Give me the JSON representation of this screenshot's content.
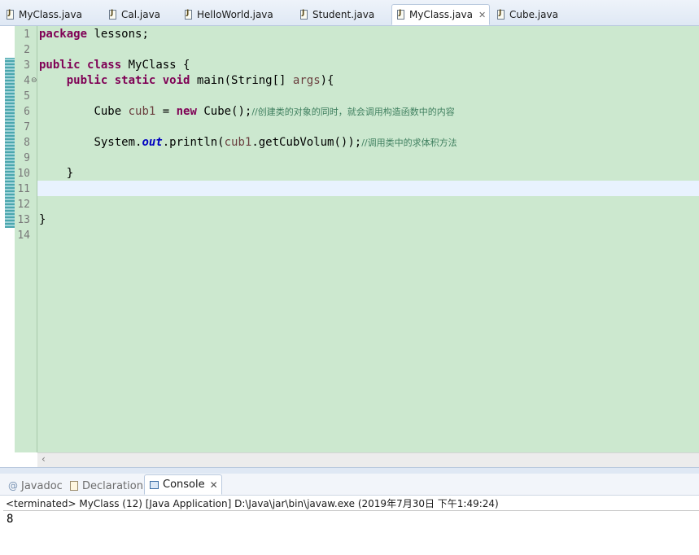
{
  "editor_tabs": [
    {
      "label": "MyClass.java",
      "active": false
    },
    {
      "label": "Cal.java",
      "active": false
    },
    {
      "label": "HelloWorld.java",
      "active": false
    },
    {
      "label": "Student.java",
      "active": false
    },
    {
      "label": "MyClass.java",
      "active": true,
      "close": "✕"
    },
    {
      "label": "Cube.java",
      "active": false
    }
  ],
  "line_numbers": [
    "1",
    "2",
    "3",
    "4",
    "5",
    "6",
    "7",
    "8",
    "9",
    "10",
    "11",
    "12",
    "13",
    "14"
  ],
  "code": {
    "l1_kw": "package",
    "l1_rest": " lessons;",
    "l3_kw1": "public",
    "l3_kw2": "class",
    "l3_rest": " MyClass {",
    "l4_kw1": "public",
    "l4_kw2": "static",
    "l4_kw3": "void",
    "l4_mid": " main(String[] ",
    "l4_var": "args",
    "l4_end": "){",
    "l6_type": "Cube ",
    "l6_var": "cub1",
    "l6_eq": " = ",
    "l6_kw": "new",
    "l6_rest": " Cube();",
    "l6_comment": "//创建类的对象的同时，就会调用构造函数中的内容",
    "l8_a": "System.",
    "l8_field": "out",
    "l8_b": ".println(",
    "l8_var": "cub1",
    "l8_c": ".getCubVolum());",
    "l8_comment": "//调用类中的求体积方法",
    "l10": "}",
    "l13": "}"
  },
  "panel_tabs": {
    "javadoc": "Javadoc",
    "declaration": "Declaration",
    "console": "Console",
    "console_close": "✕"
  },
  "console": {
    "status": "<terminated> MyClass (12) [Java Application] D:\\Java\\jar\\bin\\javaw.exe (2019年7月30日 下午1:49:24)",
    "output": "8"
  },
  "colors": {
    "editor_bg": "#cce8cf",
    "keyword": "#7f0055",
    "comment": "#3f7f5f",
    "field": "#0000c0",
    "local_var": "#6a3e3e",
    "current_line": "#e8f2fe"
  }
}
